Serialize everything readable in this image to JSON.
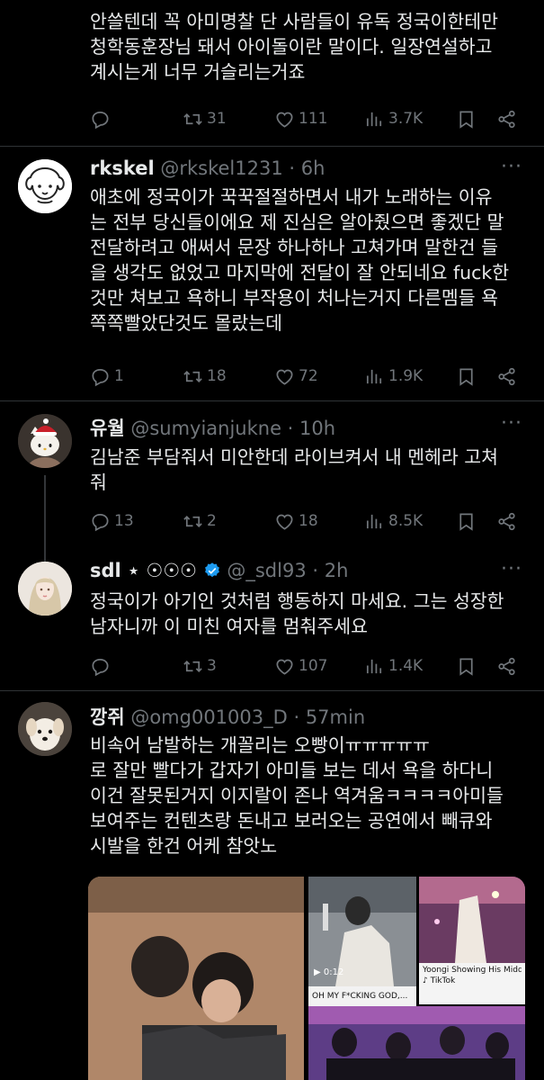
{
  "tweets": [
    {
      "text_lines": [
        "안쓸텐데 꼭 아미명찰 단 사람들이 유독 정국이한테만",
        "청학동훈장님 돼서 아이돌이란 말이다. 일장연설하고",
        "계시는게 너무 거슬리는거죠"
      ],
      "replies": "",
      "retweets": "31",
      "likes": "111",
      "views": "3.7K"
    },
    {
      "name": "rkskel",
      "handle": "@rkskel1231 · 6h",
      "text_lines": [
        "애초에 정국이가 꾹꾹절절하면서 내가 노래하는 이유",
        "는 전부 당신들이에요 제 진심은 알아줬으면 좋겠단 말",
        "전달하려고 애써서 문장 하나하나 고쳐가며 말한건 들",
        "을 생각도 없었고 마지막에 전달이 잘 안되네요 fuck한",
        "것만 쳐보고 욕하니 부작용이 처나는거지 다른멤들 욕",
        "쪽쪽빨았단것도 몰랐는데"
      ],
      "replies": "1",
      "retweets": "18",
      "likes": "72",
      "views": "1.9K"
    },
    {
      "name": "유월",
      "handle": "@sumyianjukne · 10h",
      "text_lines": [
        "김남준 부담줘서 미안한데 라이브켜서 내 멘헤라 고쳐",
        "줘"
      ],
      "replies": "13",
      "retweets": "2",
      "likes": "18",
      "views": "8.5K"
    },
    {
      "name": "sdl ⋆ ☉☉☉",
      "handle": "@_sdl93 · 2h",
      "text_lines": [
        "정국이가 아기인 것처럼 행동하지 마세요. 그는 성장한",
        "남자니까 이 미친 여자를 멈춰주세요"
      ],
      "replies": "",
      "retweets": "3",
      "likes": "107",
      "views": "1.4K"
    },
    {
      "name": "깡쥐",
      "handle": "@omg001003_D · 57min",
      "text_lines": [
        "비속어 남발하는 개꼴리는 오빵이ㅠㅠㅠㅠㅠ",
        "로 잘만 빨다가 갑자기 아미들 보는 데서 욕을 하다니",
        "이건 잘못된거지 이지랄이 존나 역겨움ㅋㅋㅋㅋ아미들",
        "보여주는 컨텐츠랑 돈내고 보러오는 공연에서 빼큐와",
        "시발을 한건 어케 참앗노"
      ],
      "media": {
        "video_time": "0:12",
        "caption1": "OH MY F*CKING GOD,...",
        "caption2": "Yoongi Showing His Middle...",
        "source2": "TikTok"
      }
    }
  ],
  "colors": {
    "background": "#000000",
    "text": "#e7e9ea",
    "muted": "#71767b",
    "verified": "#1d9bf0",
    "divider": "#2f3336"
  },
  "icons": [
    "reply-icon",
    "retweet-icon",
    "like-icon",
    "views-icon",
    "bookmark-icon",
    "share-icon",
    "more-icon",
    "verified-icon",
    "play-icon",
    "tiktok-icon"
  ]
}
